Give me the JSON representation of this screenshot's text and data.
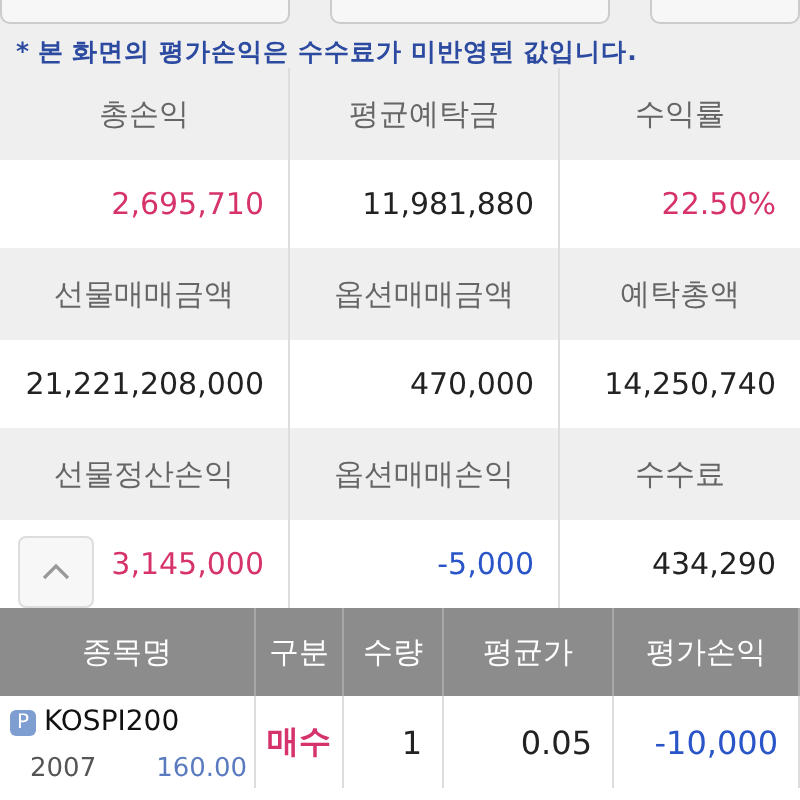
{
  "notice": "* 본 화면의 평가손익은 수수료가 미반영된 값입니다.",
  "summary": [
    {
      "label": "총손익",
      "value": "2,695,710",
      "color": "#d6336c"
    },
    {
      "label": "평균예탁금",
      "value": "11,981,880",
      "color": "#222222"
    },
    {
      "label": "수익률",
      "value": "22.50%",
      "color": "#d6336c"
    },
    {
      "label": "선물매매금액",
      "value": "21,221,208,000",
      "color": "#222222"
    },
    {
      "label": "옵션매매금액",
      "value": "470,000",
      "color": "#222222"
    },
    {
      "label": "예탁총액",
      "value": "14,250,740",
      "color": "#222222"
    },
    {
      "label": "선물정산손익",
      "value": "3,145,000",
      "color": "#d6336c"
    },
    {
      "label": "옵션매매손익",
      "value": "-5,000",
      "color": "#2a55c9"
    },
    {
      "label": "수수료",
      "value": "434,290",
      "color": "#222222"
    }
  ],
  "table": {
    "columns": [
      "종목명",
      "구분",
      "수량",
      "평균가",
      "평가손익"
    ],
    "rows": [
      {
        "name": "KOSPI200",
        "badge": "P",
        "sub_1": "2007",
        "sub_2": "160.00",
        "side": {
          "text": "매수",
          "color": "#d6336c"
        },
        "qty": "1",
        "avg": "0.05",
        "pl": {
          "text": "-10,000",
          "color": "#2a55c9"
        }
      }
    ]
  }
}
